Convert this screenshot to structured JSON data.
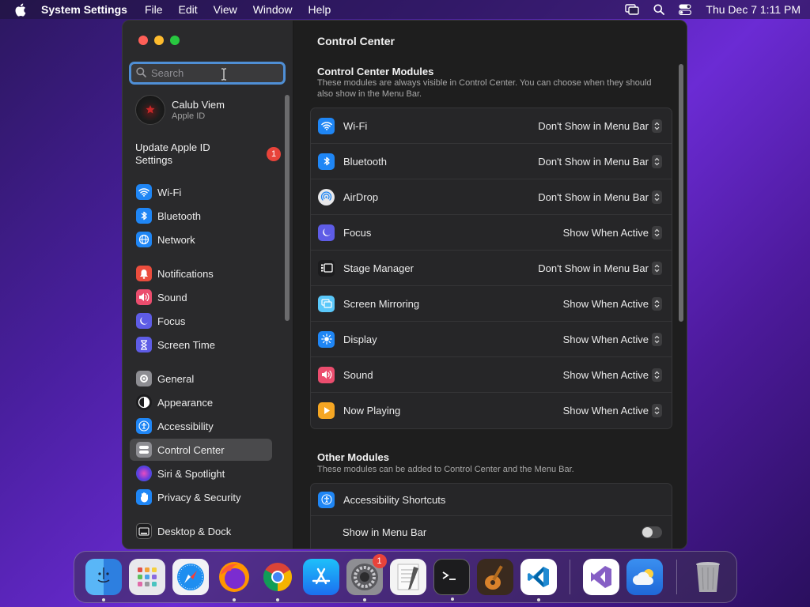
{
  "menubar": {
    "app_name": "System Settings",
    "menus": [
      "File",
      "Edit",
      "View",
      "Window",
      "Help"
    ],
    "clock": "Thu Dec 7  1:11 PM"
  },
  "sidebar": {
    "search_placeholder": "Search",
    "profile": {
      "name": "Calub Viem",
      "subtitle": "Apple ID"
    },
    "update": {
      "label": "Update Apple ID Settings",
      "badge": "1"
    },
    "items": [
      {
        "label": "Wi-Fi",
        "icon": "wifi-icon",
        "color": "#1f86f5"
      },
      {
        "label": "Bluetooth",
        "icon": "bluetooth-icon",
        "color": "#1f86f5"
      },
      {
        "label": "Network",
        "icon": "globe-icon",
        "color": "#1f86f5"
      },
      {
        "label": "Notifications",
        "icon": "bell-icon",
        "color": "#eb4d3d"
      },
      {
        "label": "Sound",
        "icon": "speaker-icon",
        "color": "#eb4d6e"
      },
      {
        "label": "Focus",
        "icon": "moon-icon",
        "color": "#5e5ce6"
      },
      {
        "label": "Screen Time",
        "icon": "hourglass-icon",
        "color": "#5e5ce6"
      },
      {
        "label": "General",
        "icon": "gear-icon",
        "color": "#8e8e93"
      },
      {
        "label": "Appearance",
        "icon": "appearance-icon",
        "color": "#1c1c1e"
      },
      {
        "label": "Accessibility",
        "icon": "accessibility-icon",
        "color": "#1f86f5"
      },
      {
        "label": "Control Center",
        "icon": "control-center-icon",
        "color": "#8e8e93"
      },
      {
        "label": "Siri & Spotlight",
        "icon": "siri-icon",
        "color": "#a04ad0"
      },
      {
        "label": "Privacy & Security",
        "icon": "hand-icon",
        "color": "#1f86f5"
      },
      {
        "label": "Desktop & Dock",
        "icon": "dock-icon",
        "color": "#1c1c1e"
      }
    ]
  },
  "main": {
    "title": "Control Center",
    "modules": {
      "heading": "Control Center Modules",
      "description": "These modules are always visible in Control Center. You can choose when they should also show in the Menu Bar.",
      "rows": [
        {
          "label": "Wi-Fi",
          "value": "Don't Show in Menu Bar",
          "icon": "wifi-icon",
          "color": "#1f86f5"
        },
        {
          "label": "Bluetooth",
          "value": "Don't Show in Menu Bar",
          "icon": "bluetooth-icon",
          "color": "#1f86f5"
        },
        {
          "label": "AirDrop",
          "value": "Don't Show in Menu Bar",
          "icon": "airdrop-icon",
          "color": "#e8e8ea"
        },
        {
          "label": "Focus",
          "value": "Show When Active",
          "icon": "moon-icon",
          "color": "#5e5ce6"
        },
        {
          "label": "Stage Manager",
          "value": "Don't Show in Menu Bar",
          "icon": "stage-manager-icon",
          "color": "#1c1c1e"
        },
        {
          "label": "Screen Mirroring",
          "value": "Show When Active",
          "icon": "screen-mirroring-icon",
          "color": "#5ac8fa"
        },
        {
          "label": "Display",
          "value": "Show When Active",
          "icon": "sun-icon",
          "color": "#1f86f5"
        },
        {
          "label": "Sound",
          "value": "Show When Active",
          "icon": "speaker-icon",
          "color": "#eb4d6e"
        },
        {
          "label": "Now Playing",
          "value": "Show When Active",
          "icon": "play-icon",
          "color": "#f5a623"
        }
      ]
    },
    "other": {
      "heading": "Other Modules",
      "description": "These modules can be added to Control Center and the Menu Bar.",
      "row_label": "Accessibility Shortcuts",
      "toggle_label": "Show in Menu Bar",
      "toggle_on": false
    }
  },
  "dock": {
    "apps": [
      {
        "name": "finder-app",
        "color": "#3d9cf0",
        "running": true
      },
      {
        "name": "launchpad-app",
        "color": "#e8e8ec",
        "running": false
      },
      {
        "name": "safari-app",
        "color": "#f2f2f5",
        "running": false
      },
      {
        "name": "firefox-app",
        "color": "#3a1f7a",
        "running": true
      },
      {
        "name": "chrome-app",
        "color": "#ffffff",
        "running": true
      },
      {
        "name": "app-store-app",
        "color": "#1b8cf5",
        "running": false
      },
      {
        "name": "system-settings-app",
        "color": "#8e8e93",
        "running": true,
        "badge": "1"
      },
      {
        "name": "textedit-app",
        "color": "#f4f4f4",
        "running": false
      },
      {
        "name": "terminal-app",
        "color": "#1c1c1e",
        "running": true
      },
      {
        "name": "garageband-app",
        "color": "#3a2a1e",
        "running": false
      },
      {
        "name": "vscode-app",
        "color": "#ffffff",
        "running": true
      },
      {
        "name": "visual-studio-app",
        "color": "#ffffff",
        "running": false
      },
      {
        "name": "weather-app",
        "color": "#2f7fe0",
        "running": false
      },
      {
        "name": "trash-app",
        "color": "#9a9a9e",
        "running": false
      }
    ]
  }
}
